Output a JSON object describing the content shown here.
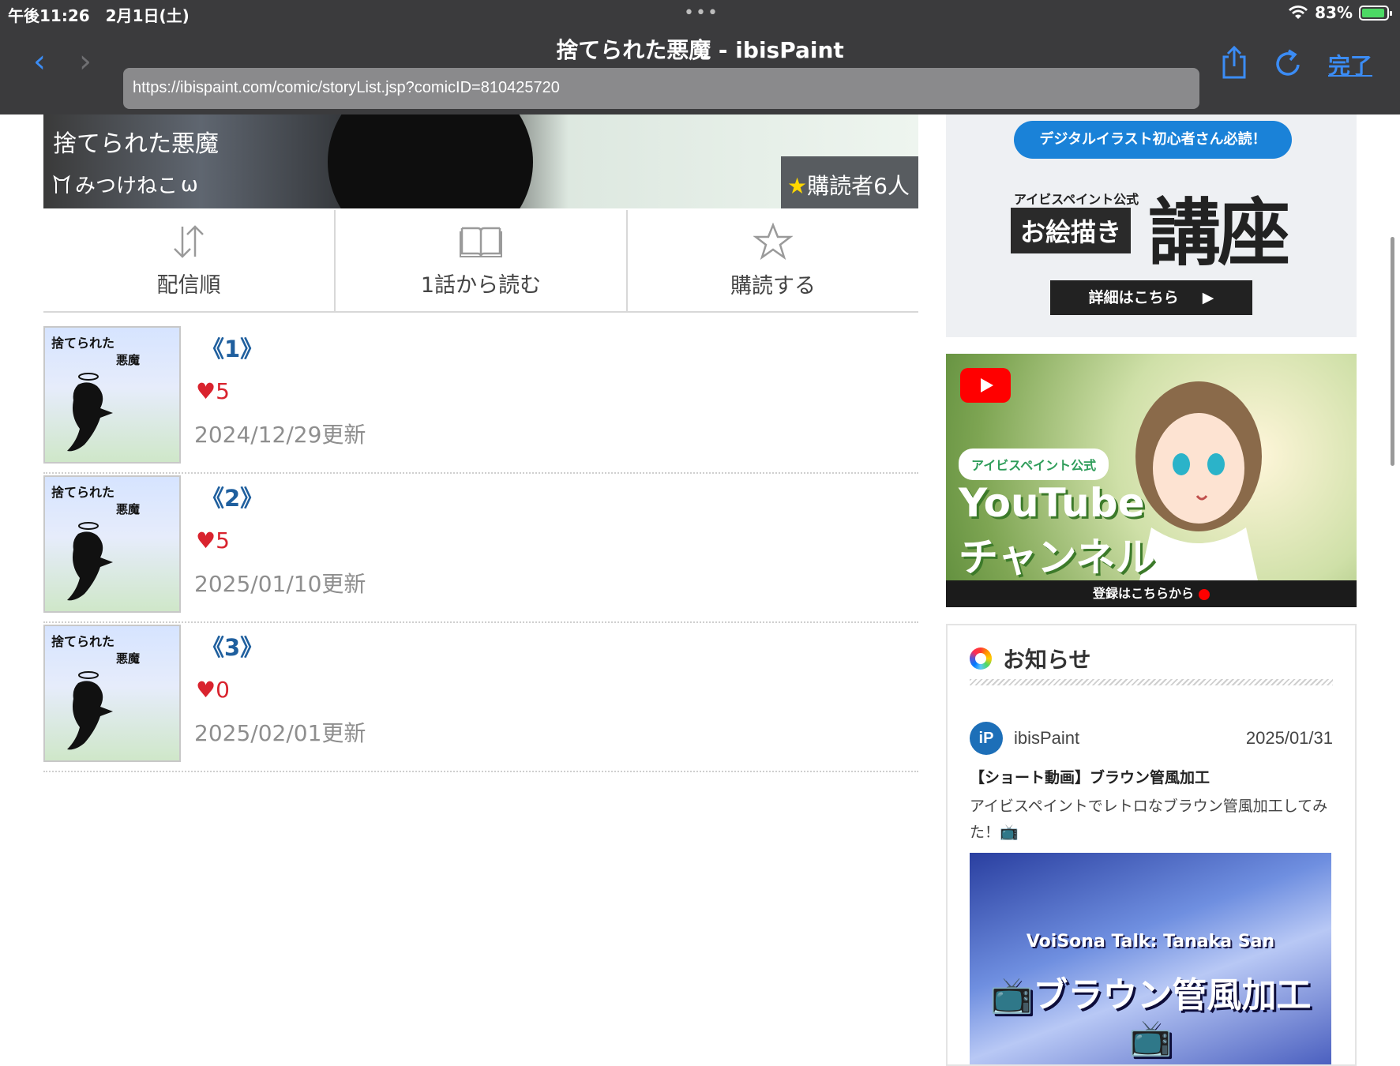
{
  "status_bar": {
    "time_date": "午後11:26　2月1日(土)",
    "dots": "•••",
    "wifi_icon": "wifi-icon",
    "battery_percent": "83%",
    "battery_level": 0.83
  },
  "browser": {
    "page_title": "捨てられた悪魔 - ibisPaint",
    "url": "https://ibispaint.com/comic/storyList.jsp?comicID=810425720",
    "back_icon": "chevron-left-icon",
    "forward_icon": "chevron-right-icon",
    "share_icon": "share-icon",
    "reload_icon": "reload-icon",
    "done_label": "完了",
    "accent_color": "#3b8cf5"
  },
  "comic": {
    "title": "捨てられた悪魔",
    "author": "みつけねこ",
    "subscribers": "購読者6人"
  },
  "actions": [
    {
      "label": "配信順",
      "icon": "sort-arrows-icon"
    },
    {
      "label": "1話から読む",
      "icon": "open-book-icon"
    },
    {
      "label": "購読する",
      "icon": "star-outline-icon"
    }
  ],
  "stories": [
    {
      "title": "《1》",
      "likes": "5",
      "date": "2024/12/29更新",
      "thumb_text1": "捨てられた",
      "thumb_text2": "悪魔"
    },
    {
      "title": "《2》",
      "likes": "5",
      "date": "2025/01/10更新",
      "thumb_text1": "捨てられた",
      "thumb_text2": "悪魔"
    },
    {
      "title": "《3》",
      "likes": "0",
      "date": "2025/02/01更新",
      "thumb_text1": "捨てられた",
      "thumb_text2": "悪魔"
    }
  ],
  "sidebar": {
    "ad1": {
      "pill": "デジタルイラスト初心者さん必読！",
      "small": "アイビスペイント公式",
      "box": "お絵描き",
      "big": "講座",
      "button": "詳細はこちら"
    },
    "ad2": {
      "pill": "アイビスペイント公式",
      "line1": "YouTube",
      "line2": "チャンネル",
      "bar": "登録はこちらから"
    },
    "news": {
      "title": "お知らせ",
      "poster": "ibisPaint",
      "date": "2025/01/31",
      "headline": "【ショート動画】ブラウン管風加工",
      "body": "アイビスペイントでレトロなブラウン管風加工してみた！📺",
      "image_line1": "VoiSona Talk: Tanaka San",
      "image_line2": "📺ブラウン管風加工📺"
    }
  }
}
